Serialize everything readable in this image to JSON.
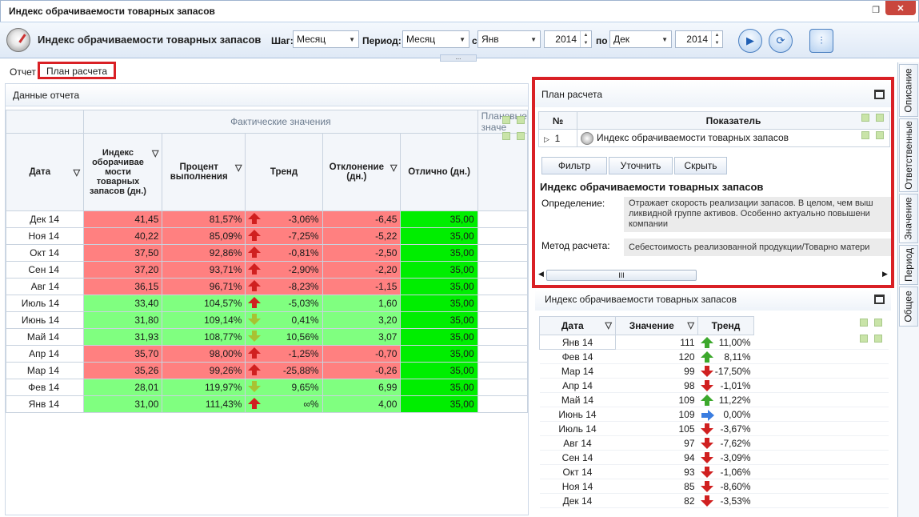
{
  "window": {
    "title": "Индекс обрачиваемости товарных запасов"
  },
  "toolbar": {
    "title": "Индекс обрачиваемости товарных запасов",
    "step_label": "Шаг:",
    "step_value": "Месяц",
    "period_label": "Период:",
    "period_value": "Месяц",
    "from_label": "с",
    "from_month": "Янв",
    "from_year": "2014",
    "to_label": "по",
    "to_month": "Дек",
    "to_year": "2014",
    "dots": "..."
  },
  "tabs": {
    "report": "Отчет",
    "plan": "План расчета"
  },
  "left": {
    "header": "Данные отчета",
    "group_actual": "Фактические значения",
    "group_plan": "Плановые значе",
    "cols": {
      "date": "Дата",
      "index": "Индекс оборачивае мости товарных запасов (дн.)",
      "percent": "Процент выполнения",
      "trend": "Тренд",
      "deviation": "Отклонение (дн.)",
      "excellent": "Отлично (дн.)"
    },
    "rows": [
      {
        "date": "Дек 14",
        "index": "41,45",
        "pct": "81,57%",
        "trend": "-3,06%",
        "dev": "-6,45",
        "exc": "35,00",
        "color": "red",
        "arrow": "upr"
      },
      {
        "date": "Ноя 14",
        "index": "40,22",
        "pct": "85,09%",
        "trend": "-7,25%",
        "dev": "-5,22",
        "exc": "35,00",
        "color": "red",
        "arrow": "upr"
      },
      {
        "date": "Окт 14",
        "index": "37,50",
        "pct": "92,86%",
        "trend": "-0,81%",
        "dev": "-2,50",
        "exc": "35,00",
        "color": "red",
        "arrow": "upr"
      },
      {
        "date": "Сен 14",
        "index": "37,20",
        "pct": "93,71%",
        "trend": "-2,90%",
        "dev": "-2,20",
        "exc": "35,00",
        "color": "red",
        "arrow": "upr"
      },
      {
        "date": "Авг 14",
        "index": "36,15",
        "pct": "96,71%",
        "trend": "-8,23%",
        "dev": "-1,15",
        "exc": "35,00",
        "color": "red",
        "arrow": "upr"
      },
      {
        "date": "Июль 14",
        "index": "33,40",
        "pct": "104,57%",
        "trend": "-5,03%",
        "dev": "1,60",
        "exc": "35,00",
        "color": "grn",
        "arrow": "upr"
      },
      {
        "date": "Июнь 14",
        "index": "31,80",
        "pct": "109,14%",
        "trend": "0,41%",
        "dev": "3,20",
        "exc": "35,00",
        "color": "grn",
        "arrow": "dny"
      },
      {
        "date": "Май 14",
        "index": "31,93",
        "pct": "108,77%",
        "trend": "10,56%",
        "dev": "3,07",
        "exc": "35,00",
        "color": "grn",
        "arrow": "dny"
      },
      {
        "date": "Апр 14",
        "index": "35,70",
        "pct": "98,00%",
        "trend": "-1,25%",
        "dev": "-0,70",
        "exc": "35,00",
        "color": "red",
        "arrow": "upr"
      },
      {
        "date": "Мар 14",
        "index": "35,26",
        "pct": "99,26%",
        "trend": "-25,88%",
        "dev": "-0,26",
        "exc": "35,00",
        "color": "red",
        "arrow": "upr"
      },
      {
        "date": "Фев 14",
        "index": "28,01",
        "pct": "119,97%",
        "trend": "9,65%",
        "dev": "6,99",
        "exc": "35,00",
        "color": "grn",
        "arrow": "dny"
      },
      {
        "date": "Янв 14",
        "index": "31,00",
        "pct": "111,43%",
        "trend": "∞%",
        "dev": "4,00",
        "exc": "35,00",
        "color": "grn",
        "arrow": "upr"
      }
    ]
  },
  "plan": {
    "header": "План расчета",
    "col_num": "№",
    "col_indicator": "Показатель",
    "row_num": "1",
    "row_name": "Индекс обрачиваемости товарных запасов",
    "btn_filter": "Фильтр",
    "btn_refine": "Уточнить",
    "btn_hide": "Скрыть",
    "ind_title": "Индекс обрачиваемости товарных запасов",
    "def_label": "Определение:",
    "def_text_1": "Отражает скорость реализации запасов. В целом, чем выш",
    "def_text_2": "ликвидной группе активов. Особенно актуально повышени",
    "def_text_3": "компании",
    "method_label": "Метод расчета:",
    "method_text": "Себестоимость реализованной продукции/Товарно матери",
    "scroll_grip": "III"
  },
  "idx": {
    "header": "Индекс обрачиваемости товарных запасов",
    "cols": {
      "date": "Дата",
      "value": "Значение",
      "trend": "Тренд"
    },
    "rows": [
      {
        "date": "Янв 14",
        "value": "111",
        "trend": "11,00%",
        "arrow": "upg"
      },
      {
        "date": "Фев 14",
        "value": "120",
        "trend": "8,11%",
        "arrow": "upg"
      },
      {
        "date": "Мар 14",
        "value": "99",
        "trend": "-17,50%",
        "arrow": "dnr"
      },
      {
        "date": "Апр 14",
        "value": "98",
        "trend": "-1,01%",
        "arrow": "dnr"
      },
      {
        "date": "Май 14",
        "value": "109",
        "trend": "11,22%",
        "arrow": "upg"
      },
      {
        "date": "Июнь 14",
        "value": "109",
        "trend": "0,00%",
        "arrow": "rtb"
      },
      {
        "date": "Июль 14",
        "value": "105",
        "trend": "-3,67%",
        "arrow": "dnr"
      },
      {
        "date": "Авг 14",
        "value": "97",
        "trend": "-7,62%",
        "arrow": "dnr"
      },
      {
        "date": "Сен 14",
        "value": "94",
        "trend": "-3,09%",
        "arrow": "dnr"
      },
      {
        "date": "Окт 14",
        "value": "93",
        "trend": "-1,06%",
        "arrow": "dnr"
      },
      {
        "date": "Ноя 14",
        "value": "85",
        "trend": "-8,60%",
        "arrow": "dnr"
      },
      {
        "date": "Дек 14",
        "value": "82",
        "trend": "-3,53%",
        "arrow": "dnr"
      }
    ]
  },
  "sidetabs": [
    "Описание",
    "Ответственные",
    "Значение",
    "Период",
    "Общее"
  ]
}
